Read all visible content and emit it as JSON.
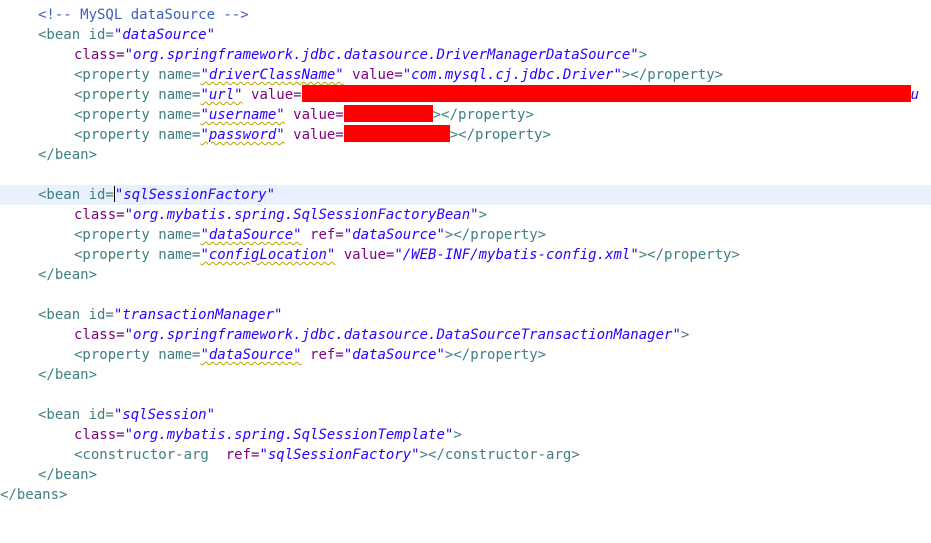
{
  "editor": {
    "comment": "<!-- MySQL dataSource -->",
    "bean1": {
      "open": "<bean id=",
      "id": "\"dataSource\"",
      "class_attr": "class=",
      "class_val": "\"org.springframework.jdbc.datasource.DriverManagerDataSource\"",
      "gt": ">",
      "p1_open": "<property name=",
      "p1_name": "\"driverClassName\"",
      "p1_attr": " value=",
      "p1_val": "\"com.mysql.cj.jdbc.Driver\"",
      "p1_close": "></property>",
      "p2_open": "<property name=",
      "p2_name": "\"url\"",
      "p2_attr": " value=",
      "p2_tail": "u",
      "p3_open": "<property name=",
      "p3_name": "\"username\"",
      "p3_attr": " value=",
      "p3_close": "></property>",
      "p4_open": "<property name=",
      "p4_name": "\"password\"",
      "p4_attr": " value=",
      "p4_close": "></property>",
      "close": "</bean>"
    },
    "bean2": {
      "open": "<bean id=",
      "id": "\"sqlSessionFactory\"",
      "class_attr": "class=",
      "class_val": "\"org.mybatis.spring.SqlSessionFactoryBean\"",
      "gt": ">",
      "p1_open": "<property name=",
      "p1_name": "\"dataSource\"",
      "p1_attr": " ref=",
      "p1_val": "\"dataSource\"",
      "p1_close": "></property>",
      "p2_open": "<property name=",
      "p2_name": "\"configLocation\"",
      "p2_attr": " value=",
      "p2_val": "\"/WEB-INF/mybatis-config.xml\"",
      "p2_close": "></property>",
      "close": "</bean>"
    },
    "bean3": {
      "open": "<bean id=",
      "id": "\"transactionManager\"",
      "class_attr": "class=",
      "class_val": "\"org.springframework.jdbc.datasource.DataSourceTransactionManager\"",
      "gt": ">",
      "p1_open": "<property name=",
      "p1_name": "\"dataSource\"",
      "p1_attr": " ref=",
      "p1_val": "\"dataSource\"",
      "p1_close": "></property>",
      "close": "</bean>"
    },
    "bean4": {
      "open": "<bean id=",
      "id": "\"sqlSession\"",
      "class_attr": "class=",
      "class_val": "\"org.mybatis.spring.SqlSessionTemplate\"",
      "gt": ">",
      "ca_open": "<constructor-arg",
      "ca_attr": "  ref=",
      "ca_val": "\"sqlSessionFactory\"",
      "ca_close": "></constructor-arg>",
      "close": "</bean>"
    },
    "beans_close": "</beans>"
  },
  "colors": {
    "comment": "#3f5fbf",
    "tag": "#3f7f7f",
    "attribute": "#7f007f",
    "value": "#2a00ff",
    "redaction": "#ff0000",
    "current_line": "#e8f2fe"
  }
}
